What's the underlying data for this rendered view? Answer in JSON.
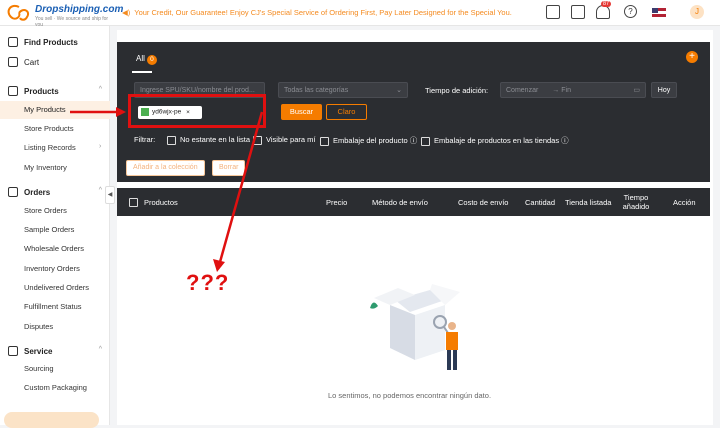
{
  "header": {
    "brand": "Dropshipping.com",
    "tagline": "You sell · We source and ship for you",
    "notice": "Your Credit, Our Guarantee! Enjoy CJ's Special Service of Ordering First, Pay Later Designed for the Special You.",
    "notif_count": "87",
    "avatar_letter": "J"
  },
  "sidebar": {
    "find_products": "Find Products",
    "cart": "Cart",
    "products": "Products",
    "product_items": [
      "My Products",
      "Store Products",
      "Listing Records",
      "My Inventory"
    ],
    "orders": "Orders",
    "order_items": [
      "Store Orders",
      "Sample Orders",
      "Wholesale Orders",
      "Inventory Orders",
      "Undelivered Orders",
      "Fulfillment Status",
      "Disputes"
    ],
    "service": "Service",
    "service_items": [
      "Sourcing",
      "Custom Packaging"
    ]
  },
  "main": {
    "tab_all": "All",
    "tab_count": "0",
    "search_placeholder": "Ingrese SPU/SKU/nombre del prod...",
    "categories": "Todas las categorías",
    "date_label": "Tiempo de adición:",
    "date_start": "Comenzar",
    "date_end": "Fin",
    "today": "Hoy",
    "chip": "yd6wjx-pe",
    "search_btn": "Buscar",
    "clear_btn": "Claro",
    "filter_label": "Filtrar:",
    "filters": [
      "No estante en la lista",
      "Visible para mí",
      "Embalaje del producto ⓘ",
      "Embalaje de productos en las tiendas ⓘ"
    ],
    "add_collection": "Añadir a la colección",
    "delete_btn": "Borrar",
    "columns": [
      "Productos",
      "Precio",
      "Método de envío",
      "Costo de envío",
      "Cantidad",
      "Tienda listada",
      "Tiempo añadido",
      "Acción"
    ],
    "empty_text": "Lo sentimos, no podemos encontrar ningún dato.",
    "annotation": "???"
  }
}
